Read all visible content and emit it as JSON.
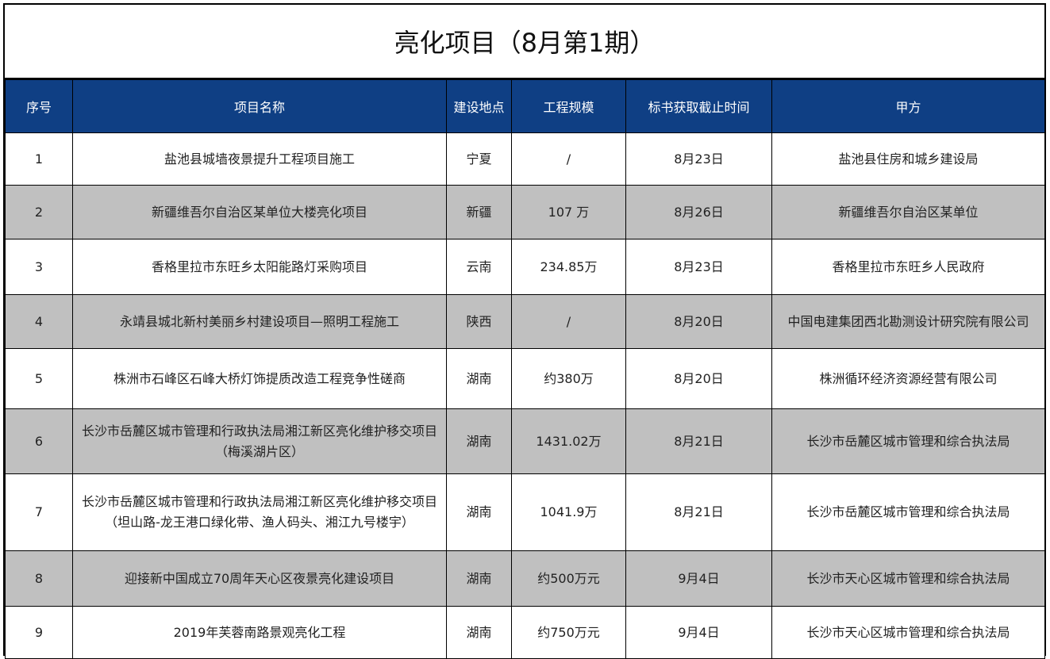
{
  "title": "亮化项目（8月第1期）",
  "headers": [
    "序号",
    "项目名称",
    "建设地点",
    "工程规模",
    "标书获取截止时间",
    "甲方"
  ],
  "rows": [
    {
      "no": "1",
      "name": "盐池县城墙夜景提升工程项目施工",
      "location": "宁夏",
      "scale": "/",
      "deadline": "8月23日",
      "owner": "盐池县住房和城乡建设局"
    },
    {
      "no": "2",
      "name": "新疆维吾尔自治区某单位大楼亮化项目",
      "location": "新疆",
      "scale": "107 万",
      "deadline": "8月26日",
      "owner": "新疆维吾尔自治区某单位"
    },
    {
      "no": "3",
      "name": "香格里拉市东旺乡太阳能路灯采购项目",
      "location": "云南",
      "scale": "234.85万",
      "deadline": "8月23日",
      "owner": "香格里拉市东旺乡人民政府"
    },
    {
      "no": "4",
      "name": "永靖县城北新村美丽乡村建设项目—照明工程施工",
      "location": "陕西",
      "scale": "/",
      "deadline": "8月20日",
      "owner": "中国电建集团西北勘测设计研究院有限公司"
    },
    {
      "no": "5",
      "name": "株洲市石峰区石峰大桥灯饰提质改造工程竞争性磋商",
      "location": "湖南",
      "scale": "约380万",
      "deadline": "8月20日",
      "owner": "株洲循环经济资源经营有限公司"
    },
    {
      "no": "6",
      "name": "长沙市岳麓区城市管理和行政执法局湘江新区亮化维护移交项目（梅溪湖片区）",
      "location": "湖南",
      "scale": "1431.02万",
      "deadline": "8月21日",
      "owner": "长沙市岳麓区城市管理和综合执法局"
    },
    {
      "no": "7",
      "name": "长沙市岳麓区城市管理和行政执法局湘江新区亮化维护移交项目（坦山路-龙王港口绿化带、渔人码头、湘江九号楼宇）",
      "location": "湖南",
      "scale": "1041.9万",
      "deadline": "8月21日",
      "owner": "长沙市岳麓区城市管理和综合执法局"
    },
    {
      "no": "8",
      "name": "迎接新中国成立70周年天心区夜景亮化建设项目",
      "location": "湖南",
      "scale": "约500万元",
      "deadline": "9月4日",
      "owner": "长沙市天心区城市管理和综合执法局"
    },
    {
      "no": "9",
      "name": "2019年芙蓉南路景观亮化工程",
      "location": "湖南",
      "scale": "约750万元",
      "deadline": "9月4日",
      "owner": "长沙市天心区城市管理和综合执法局"
    }
  ]
}
